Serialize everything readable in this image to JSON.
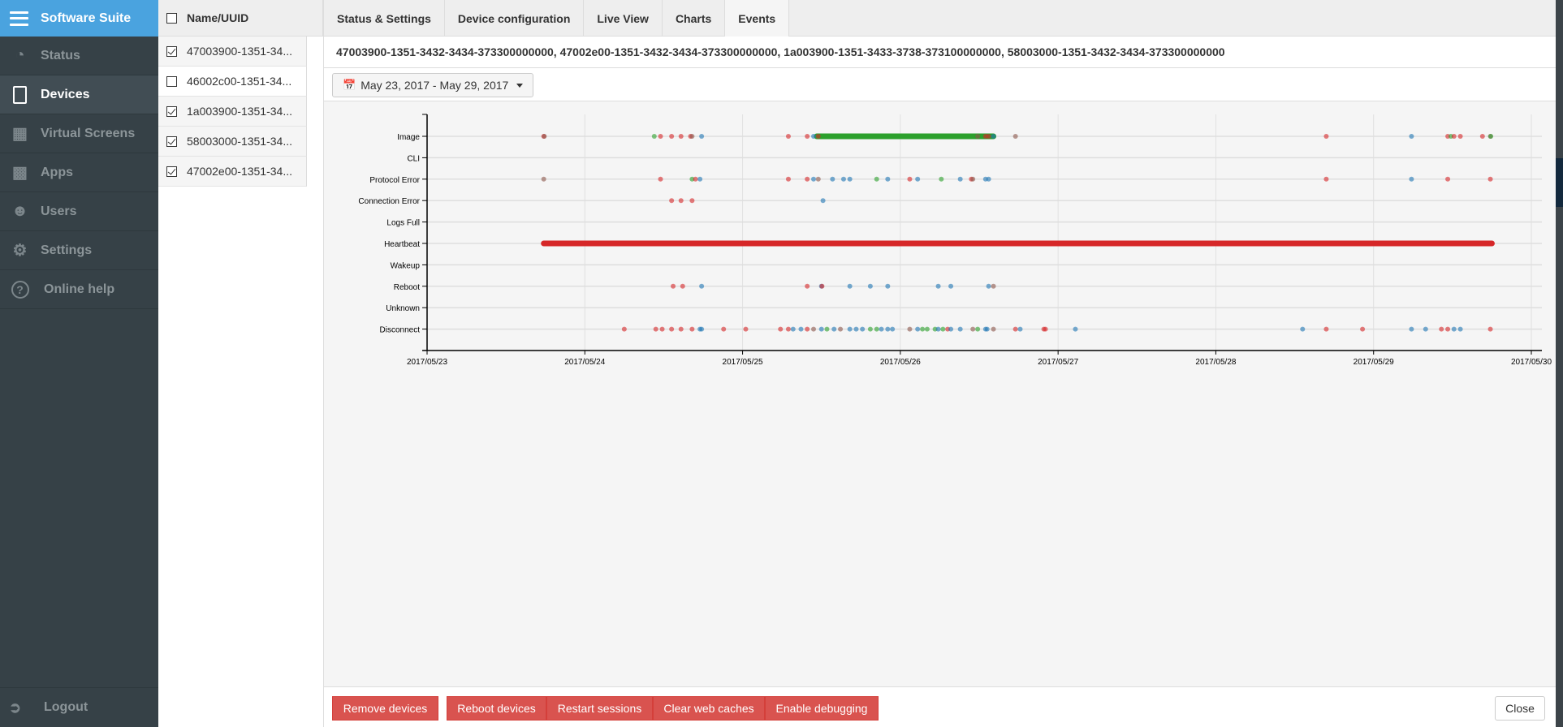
{
  "app": {
    "title": "Software Suite"
  },
  "sidebar": {
    "items": [
      {
        "label": "Status",
        "icon": "dashboard-icon",
        "active": false
      },
      {
        "label": "Devices",
        "icon": "tablet-icon",
        "active": true
      },
      {
        "label": "Virtual Screens",
        "icon": "grid-icon",
        "active": false
      },
      {
        "label": "Apps",
        "icon": "puzzle-icon",
        "active": false
      },
      {
        "label": "Users",
        "icon": "users-icon",
        "active": false
      },
      {
        "label": "Settings",
        "icon": "gear-icon",
        "active": false
      },
      {
        "label": "Online help",
        "icon": "question-circle-icon",
        "active": false
      }
    ],
    "logout": "Logout"
  },
  "devices": {
    "header": "Name/UUID",
    "rows": [
      {
        "name": "47003900-1351-34...",
        "checked": true
      },
      {
        "name": "46002c00-1351-34...",
        "checked": false
      },
      {
        "name": "1a003900-1351-34...",
        "checked": true
      },
      {
        "name": "58003000-1351-34...",
        "checked": true
      },
      {
        "name": "47002e00-1351-34...",
        "checked": true
      }
    ]
  },
  "tabs": [
    {
      "label": "Status & Settings",
      "active": false
    },
    {
      "label": "Device configuration",
      "active": false
    },
    {
      "label": "Live View",
      "active": false
    },
    {
      "label": "Charts",
      "active": false
    },
    {
      "label": "Events",
      "active": true
    }
  ],
  "main": {
    "selected_devices": "47003900-1351-3432-3434-373300000000, 47002e00-1351-3432-3434-373300000000, 1a003900-1351-3433-3738-373100000000, 58003000-1351-3432-3434-373300000000",
    "date_range": "May 23, 2017 - May 29, 2017"
  },
  "footer": {
    "buttons": [
      "Remove devices",
      "Reboot devices",
      "Restart sessions",
      "Clear web caches",
      "Enable debugging"
    ],
    "close": "Close"
  },
  "colors": {
    "accent": "#4aa3df",
    "danger": "#d9534f",
    "red": "#d62728",
    "blue": "#1f77b4",
    "green": "#2ca02c",
    "brown": "#8c564b"
  },
  "chart_data": {
    "type": "scatter",
    "grid": true,
    "x_range": [
      "2017-05-23T00:00",
      "2017-05-30T00:00"
    ],
    "x_ticks": [
      "2017/05/23",
      "2017/05/24",
      "2017/05/25",
      "2017/05/26",
      "2017/05/27",
      "2017/05/28",
      "2017/05/29",
      "2017/05/30"
    ],
    "categories": [
      "Image",
      "CLI",
      "Protocol Error",
      "Connection Error",
      "Logs Full",
      "Heartbeat",
      "Wakeup",
      "Reboot",
      "Unknown",
      "Disconnect"
    ],
    "dense_ranges": [
      {
        "category": "Image",
        "from": "2017-05-25T11:17",
        "to": "2017-05-26T14:10",
        "color": "green"
      },
      {
        "category": "Heartbeat",
        "from": "2017-05-23T17:45",
        "to": "2017-05-29T18:00",
        "color": "red"
      }
    ],
    "points": {
      "Image": [
        [
          "2017-05-23T17:45",
          "red"
        ],
        [
          "2017-05-23T17:50",
          "brown"
        ],
        [
          "2017-05-24T10:34",
          "green"
        ],
        [
          "2017-05-24T11:31",
          "red"
        ],
        [
          "2017-05-24T13:12",
          "red"
        ],
        [
          "2017-05-24T14:38",
          "red"
        ],
        [
          "2017-05-24T16:05",
          "red"
        ],
        [
          "2017-05-24T16:19",
          "brown"
        ],
        [
          "2017-05-24T17:46",
          "blue"
        ],
        [
          "2017-05-25T06:58",
          "red"
        ],
        [
          "2017-05-25T09:50",
          "red"
        ],
        [
          "2017-05-25T10:48",
          "blue"
        ],
        [
          "2017-05-25T11:31",
          "red"
        ],
        [
          "2017-05-26T11:46",
          "brown"
        ],
        [
          "2017-05-26T12:58",
          "red"
        ],
        [
          "2017-05-26T13:26",
          "red"
        ],
        [
          "2017-05-26T14:10",
          "blue"
        ],
        [
          "2017-05-26T17:31",
          "brown"
        ],
        [
          "2017-05-28T16:48",
          "red"
        ],
        [
          "2017-05-29T05:46",
          "blue"
        ],
        [
          "2017-05-29T11:17",
          "red"
        ],
        [
          "2017-05-29T11:46",
          "green"
        ],
        [
          "2017-05-29T12:14",
          "red"
        ],
        [
          "2017-05-29T13:12",
          "red"
        ],
        [
          "2017-05-29T16:34",
          "red"
        ],
        [
          "2017-05-29T17:46",
          "brown"
        ],
        [
          "2017-05-29T17:50",
          "green"
        ]
      ],
      "CLI": [],
      "Protocol Error": [
        [
          "2017-05-23T17:45",
          "brown"
        ],
        [
          "2017-05-24T11:31",
          "red"
        ],
        [
          "2017-05-24T16:19",
          "green"
        ],
        [
          "2017-05-24T16:50",
          "red"
        ],
        [
          "2017-05-24T17:31",
          "blue"
        ],
        [
          "2017-05-25T06:58",
          "red"
        ],
        [
          "2017-05-25T09:50",
          "red"
        ],
        [
          "2017-05-25T10:48",
          "blue"
        ],
        [
          "2017-05-25T11:31",
          "brown"
        ],
        [
          "2017-05-25T13:41",
          "blue"
        ],
        [
          "2017-05-25T15:22",
          "blue"
        ],
        [
          "2017-05-25T16:19",
          "blue"
        ],
        [
          "2017-05-25T20:24",
          "green"
        ],
        [
          "2017-05-25T22:05",
          "blue"
        ],
        [
          "2017-05-26T01:26",
          "red"
        ],
        [
          "2017-05-26T02:38",
          "blue"
        ],
        [
          "2017-05-26T06:14",
          "green"
        ],
        [
          "2017-05-26T09:07",
          "blue"
        ],
        [
          "2017-05-26T10:48",
          "red"
        ],
        [
          "2017-05-26T11:02",
          "brown"
        ],
        [
          "2017-05-26T12:58",
          "blue"
        ],
        [
          "2017-05-26T13:26",
          "blue"
        ],
        [
          "2017-05-28T16:48",
          "red"
        ],
        [
          "2017-05-29T05:46",
          "blue"
        ],
        [
          "2017-05-29T11:17",
          "red"
        ],
        [
          "2017-05-29T17:46",
          "red"
        ]
      ],
      "Connection Error": [
        [
          "2017-05-24T13:12",
          "red"
        ],
        [
          "2017-05-24T14:38",
          "red"
        ],
        [
          "2017-05-24T16:19",
          "red"
        ],
        [
          "2017-05-25T12:14",
          "blue"
        ]
      ],
      "Logs Full": [],
      "Heartbeat": [],
      "Wakeup": [],
      "Reboot": [
        [
          "2017-05-24T13:26",
          "red"
        ],
        [
          "2017-05-24T14:53",
          "red"
        ],
        [
          "2017-05-24T17:46",
          "blue"
        ],
        [
          "2017-05-25T09:50",
          "red"
        ],
        [
          "2017-05-25T12:00",
          "blue"
        ],
        [
          "2017-05-25T12:05",
          "red"
        ],
        [
          "2017-05-25T16:19",
          "blue"
        ],
        [
          "2017-05-25T19:26",
          "blue"
        ],
        [
          "2017-05-25T22:05",
          "blue"
        ],
        [
          "2017-05-26T05:46",
          "blue"
        ],
        [
          "2017-05-26T07:41",
          "blue"
        ],
        [
          "2017-05-26T13:26",
          "blue"
        ],
        [
          "2017-05-26T14:10",
          "brown"
        ]
      ],
      "Unknown": [],
      "Disconnect": [
        [
          "2017-05-24T06:00",
          "red"
        ],
        [
          "2017-05-24T10:48",
          "red"
        ],
        [
          "2017-05-24T11:46",
          "red"
        ],
        [
          "2017-05-24T13:12",
          "red"
        ],
        [
          "2017-05-24T14:38",
          "red"
        ],
        [
          "2017-05-24T16:19",
          "red"
        ],
        [
          "2017-05-24T17:31",
          "blue"
        ],
        [
          "2017-05-24T17:46",
          "blue"
        ],
        [
          "2017-05-24T21:07",
          "red"
        ],
        [
          "2017-05-25T00:29",
          "red"
        ],
        [
          "2017-05-25T05:46",
          "red"
        ],
        [
          "2017-05-25T06:58",
          "red"
        ],
        [
          "2017-05-25T07:41",
          "blue"
        ],
        [
          "2017-05-25T08:53",
          "blue"
        ],
        [
          "2017-05-25T09:50",
          "red"
        ],
        [
          "2017-05-25T10:48",
          "brown"
        ],
        [
          "2017-05-25T12:00",
          "blue"
        ],
        [
          "2017-05-25T12:50",
          "green"
        ],
        [
          "2017-05-25T13:55",
          "blue"
        ],
        [
          "2017-05-25T14:53",
          "brown"
        ],
        [
          "2017-05-25T16:19",
          "blue"
        ],
        [
          "2017-05-25T17:17",
          "blue"
        ],
        [
          "2017-05-25T18:14",
          "blue"
        ],
        [
          "2017-05-25T19:26",
          "green"
        ],
        [
          "2017-05-25T20:24",
          "green"
        ],
        [
          "2017-05-25T21:07",
          "blue"
        ],
        [
          "2017-05-25T22:05",
          "blue"
        ],
        [
          "2017-05-25T22:48",
          "blue"
        ],
        [
          "2017-05-26T01:26",
          "brown"
        ],
        [
          "2017-05-26T02:38",
          "blue"
        ],
        [
          "2017-05-26T03:22",
          "green"
        ],
        [
          "2017-05-26T04:05",
          "green"
        ],
        [
          "2017-05-26T05:17",
          "green"
        ],
        [
          "2017-05-26T05:46",
          "blue"
        ],
        [
          "2017-05-26T06:29",
          "green"
        ],
        [
          "2017-05-26T07:12",
          "red"
        ],
        [
          "2017-05-26T07:41",
          "blue"
        ],
        [
          "2017-05-26T09:07",
          "blue"
        ],
        [
          "2017-05-26T11:02",
          "brown"
        ],
        [
          "2017-05-26T11:46",
          "green"
        ],
        [
          "2017-05-26T12:58",
          "blue"
        ],
        [
          "2017-05-26T13:12",
          "blue"
        ],
        [
          "2017-05-26T14:10",
          "brown"
        ],
        [
          "2017-05-26T17:31",
          "red"
        ],
        [
          "2017-05-26T18:14",
          "blue"
        ],
        [
          "2017-05-26T21:50",
          "red"
        ],
        [
          "2017-05-26T22:05",
          "red"
        ],
        [
          "2017-05-27T02:38",
          "blue"
        ],
        [
          "2017-05-28T13:12",
          "blue"
        ],
        [
          "2017-05-28T16:48",
          "red"
        ],
        [
          "2017-05-28T22:19",
          "red"
        ],
        [
          "2017-05-29T05:46",
          "blue"
        ],
        [
          "2017-05-29T07:55",
          "blue"
        ],
        [
          "2017-05-29T10:19",
          "red"
        ],
        [
          "2017-05-29T11:17",
          "red"
        ],
        [
          "2017-05-29T12:14",
          "blue"
        ],
        [
          "2017-05-29T13:12",
          "blue"
        ],
        [
          "2017-05-29T17:46",
          "red"
        ]
      ]
    }
  }
}
